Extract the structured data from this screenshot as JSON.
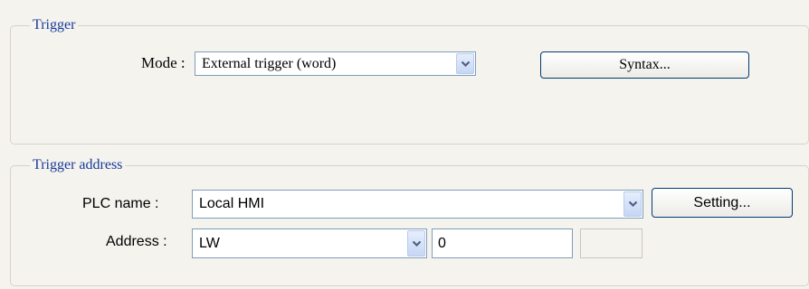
{
  "trigger_group": {
    "title": "Trigger",
    "mode_label": "Mode :",
    "mode_value": "External trigger (word)",
    "syntax_button": "Syntax..."
  },
  "trigger_address_group": {
    "title": "Trigger address",
    "plc_name_label": "PLC name :",
    "plc_name_value": "Local HMI",
    "setting_button": "Setting...",
    "address_label": "Address :",
    "address_type_value": "LW",
    "address_value": "0",
    "extra_value": ""
  },
  "icons": {
    "dropdown": "chevron-down-icon"
  },
  "colors": {
    "groupbox_title": "#1a3a9c",
    "dropdown_arrow": "#4d6185",
    "background": "#f4f3ee"
  }
}
